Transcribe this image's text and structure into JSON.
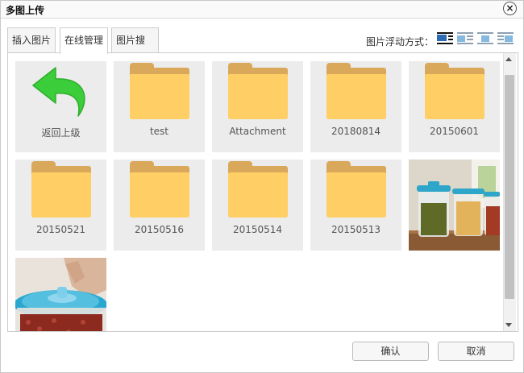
{
  "window": {
    "title": "多图上传",
    "close_glyph": "×"
  },
  "tabs": [
    {
      "label": "插入图片",
      "active": false
    },
    {
      "label": "在线管理",
      "active": true
    },
    {
      "label": "图片搜索",
      "active": false
    }
  ],
  "float_mode": {
    "label": "图片浮动方式：",
    "options": [
      "none",
      "left",
      "center",
      "right"
    ],
    "selected": "none"
  },
  "items": [
    {
      "type": "back",
      "label": "返回上级",
      "icon": "back-arrow-icon"
    },
    {
      "type": "folder",
      "label": "test",
      "icon": "folder-icon"
    },
    {
      "type": "folder",
      "label": "Attachment",
      "icon": "folder-icon"
    },
    {
      "type": "folder",
      "label": "20180814",
      "icon": "folder-icon"
    },
    {
      "type": "folder",
      "label": "20150601",
      "icon": "folder-icon"
    },
    {
      "type": "folder",
      "label": "20150521",
      "icon": "folder-icon"
    },
    {
      "type": "folder",
      "label": "20150516",
      "icon": "folder-icon"
    },
    {
      "type": "folder",
      "label": "20150514",
      "icon": "folder-icon"
    },
    {
      "type": "folder",
      "label": "20150513",
      "icon": "folder-icon"
    },
    {
      "type": "image",
      "subject": "glass jars with beans and grains"
    },
    {
      "type": "image",
      "subject": "blue-lid jar of red beans"
    }
  ],
  "buttons": {
    "ok": "确认",
    "cancel": "取消"
  },
  "colors": {
    "folder": "#ffcf66",
    "folder_back": "#d9a85a",
    "back_arrow": "#3ccd3a",
    "tile_bg": "#ececec"
  }
}
